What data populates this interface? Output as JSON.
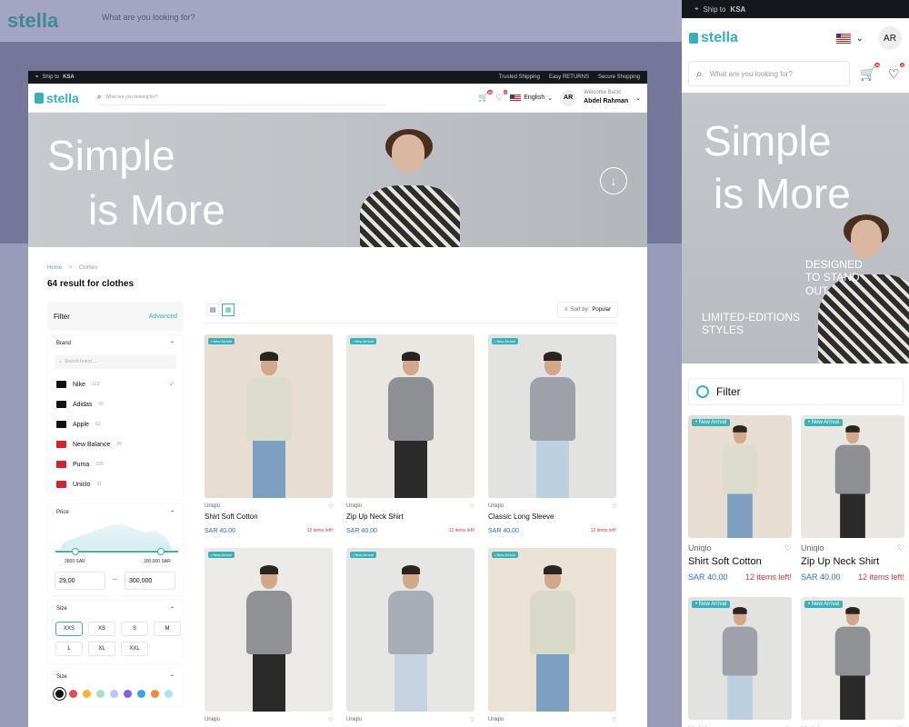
{
  "bg": {
    "logo": "stella",
    "search_placeholder": "What are you looking for?"
  },
  "topbar": {
    "ship_label": "Ship to",
    "ship_country": "KSA",
    "flag_badge": "",
    "features": [
      "Trusted Shipping",
      "Easy RETURNS",
      "Secure Shopping"
    ]
  },
  "header": {
    "logo": "stella",
    "search_placeholder": "What are you looking for?",
    "cart_count": "20",
    "wish_count": "3",
    "language": "English",
    "avatar": "AR",
    "welcome": "Welcome Back!",
    "user": "Abdel Rahman"
  },
  "hero": {
    "line1": "Simple",
    "line2": "is More"
  },
  "breadcrumb": {
    "home": "Home",
    "sep": ">",
    "current": "Clothes"
  },
  "result_title": "64 result for clothes",
  "filter": {
    "title": "Filter",
    "advanced": "Advanced",
    "brand_title": "Brand",
    "brand_search": "Search brand ...",
    "brands": [
      {
        "name": "Nike",
        "count": "123",
        "checked": true
      },
      {
        "name": "Adidas",
        "count": "55"
      },
      {
        "name": "Apple",
        "count": "63"
      },
      {
        "name": "New Balance",
        "count": "99"
      },
      {
        "name": "Puma",
        "count": "325"
      },
      {
        "name": "Uniclo",
        "count": "41"
      }
    ],
    "price_title": "Price",
    "min_label": "2800 SAR",
    "max_label": "300,000 SAR",
    "min_value": "29,00",
    "max_value": "300,000",
    "dash": "—",
    "size_title": "Size",
    "sizes": [
      "XXS",
      "XS",
      "S",
      "M",
      "L",
      "XL",
      "XXL"
    ],
    "selected_size": "XXS",
    "color_title": "Size",
    "colors": [
      "#111111",
      "#e84a4a",
      "#f2b634",
      "#a7dfc6",
      "#b9c9f2",
      "#8e5be8",
      "#3aa3e8",
      "#f28a3a",
      "#a6e8f2"
    ]
  },
  "sort": {
    "label": "Sort by:",
    "value": "Popular"
  },
  "products": [
    {
      "brand": "Uniqlo",
      "name": "Shirt Soft Cotton",
      "price": "SAR 40.00",
      "left": "12 items left!",
      "tag": "New Arrival",
      "top": "#dcdccd",
      "bottom": "#7e9fbf",
      "bg": "#e7ddd2"
    },
    {
      "brand": "Uniqlo",
      "name": "Zip Up Neck Shirt",
      "price": "SAR 40.00",
      "left": "12 items left!",
      "tag": "New Arrival",
      "top": "#8d8f93",
      "bottom": "#2b2b2b",
      "bg": "#eae7e3"
    },
    {
      "brand": "Uniqlo",
      "name": "Classic Long Sleeve",
      "price": "SAR 40.00",
      "left": "12 items left!",
      "tag": "New Arrival",
      "top": "#9ea2a8",
      "bottom": "#bcd0df",
      "bg": "#e2e2e1"
    },
    {
      "brand": "Uniqlo",
      "name": "",
      "price": "",
      "left": "",
      "tag": "New Arrival",
      "top": "#8f9195",
      "bottom": "#2a2a2a",
      "bg": "#eceae6"
    },
    {
      "brand": "Uniqlo",
      "name": "",
      "price": "",
      "left": "",
      "tag": "New Arrival",
      "top": "#a7adb5",
      "bottom": "#c4d3df",
      "bg": "#e6e6e4"
    },
    {
      "brand": "Uniqlo",
      "name": "",
      "price": "",
      "left": "",
      "tag": "New Arrival",
      "top": "#d9d9ca",
      "bottom": "#7e9fbf",
      "bg": "#ebe2d6"
    }
  ],
  "mobile": {
    "ship_label": "Ship to",
    "ship_country": "KSA",
    "logo": "stella",
    "avatar": "AR",
    "search_placeholder": "What are you looking for?",
    "cart_count": "20",
    "wish_count": "3",
    "hero1": "Simple",
    "hero2": "is More",
    "tag1": "DESIGNED TO STAND OUT",
    "tag2": "LIMITED-EDITIONS STYLES",
    "filter": "Filter"
  }
}
